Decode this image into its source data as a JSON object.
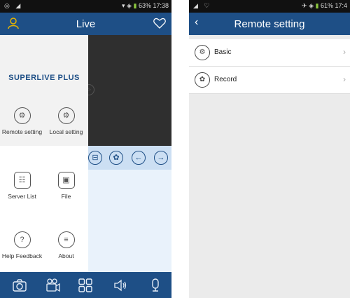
{
  "left": {
    "status": {
      "left": "◎ ◢",
      "right": "63% 17:38"
    },
    "title": "Live",
    "brand": "SUPERLIVE PLUS",
    "drawer_items": [
      {
        "label": "Remote setting",
        "icon": "gear-icon"
      },
      {
        "label": "Local setting",
        "icon": "gear-icon"
      },
      {
        "label": "Server List",
        "icon": "server-list-icon"
      },
      {
        "label": "File",
        "icon": "image-file-icon"
      },
      {
        "label": "Help Feedback",
        "icon": "question-icon"
      },
      {
        "label": "About",
        "icon": "menu-icon"
      }
    ],
    "bottom_icons": [
      "camera-icon",
      "video-camera-icon",
      "grid-icon",
      "speaker-icon",
      "microphone-icon"
    ]
  },
  "right": {
    "status": {
      "left": "◢ ♡",
      "right": "61% 17:4"
    },
    "title": "Remote setting",
    "rows": [
      {
        "label": "Basic",
        "icon": "gear-icon"
      },
      {
        "label": "Record",
        "icon": "film-reel-icon"
      }
    ]
  },
  "colors": {
    "appbar": "#1e4f86",
    "control_row": "#ccdff3"
  }
}
